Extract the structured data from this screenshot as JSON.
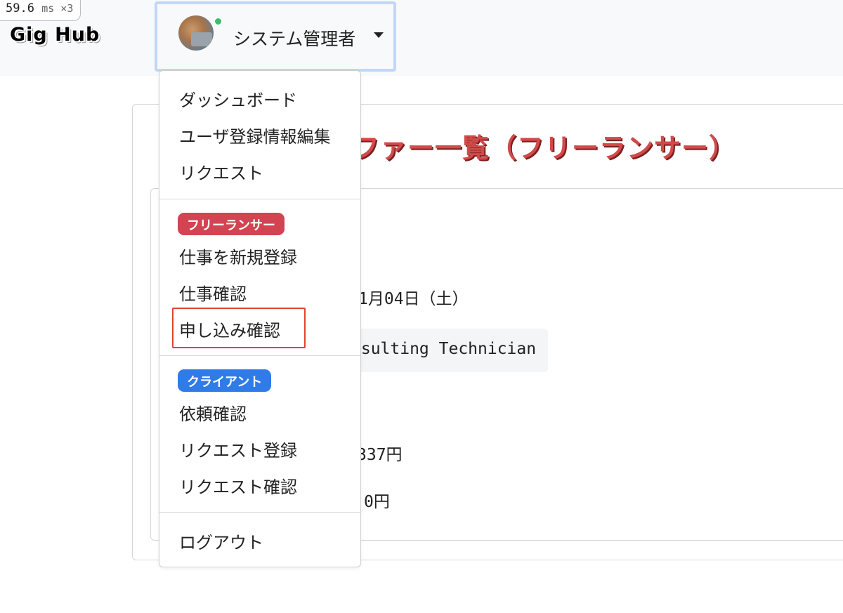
{
  "perf": {
    "value": "59.6",
    "unit": "ms ×3"
  },
  "brand": "Gig Hub",
  "user": {
    "name": "システム管理者",
    "status": "online"
  },
  "background": {
    "title": "オファー一覧（フリーランサー）",
    "visible_title_fragment": "ファー一覧（フリーランサー）",
    "date_fragment": "1月04日（土）",
    "job_fragment": "nsulting Technician",
    "price_fragment_1": "337円",
    "price_fragment_2": "0円"
  },
  "menu": {
    "general": [
      {
        "label": "ダッシュボード"
      },
      {
        "label": "ユーザ登録情報編集"
      },
      {
        "label": "リクエスト"
      }
    ],
    "freelancer": {
      "badge": "フリーランサー",
      "badge_color": "#d24452",
      "items": [
        {
          "label": "仕事を新規登録"
        },
        {
          "label": "仕事確認"
        },
        {
          "label": "申し込み確認",
          "highlighted": true
        }
      ]
    },
    "client": {
      "badge": "クライアント",
      "badge_color": "#2f7be8",
      "items": [
        {
          "label": "依頼確認"
        },
        {
          "label": "リクエスト登録"
        },
        {
          "label": "リクエスト確認"
        }
      ]
    },
    "logout": "ログアウト"
  },
  "colors": {
    "accent_red": "#d24a4a",
    "highlight_border": "#e0462f",
    "toggle_focus": "#c2d6f7"
  }
}
